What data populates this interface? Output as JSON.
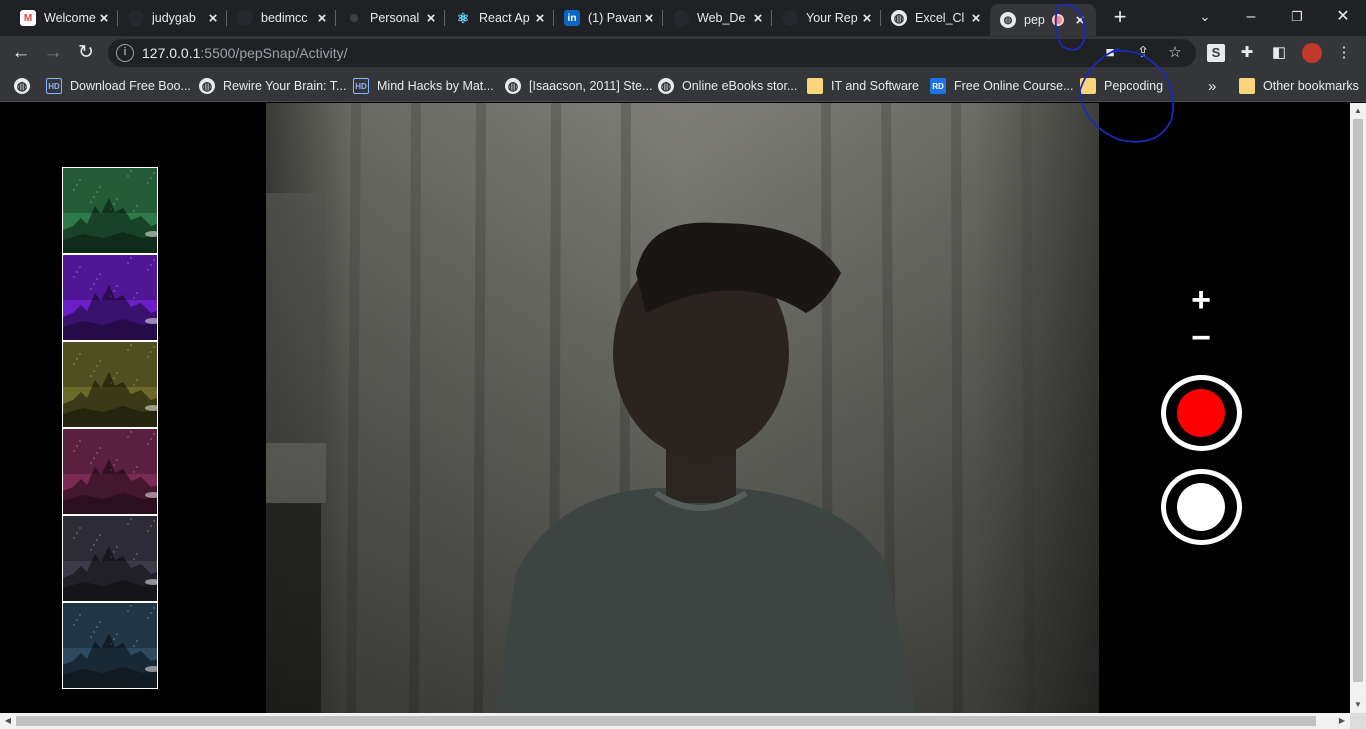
{
  "tabs": [
    {
      "title": "Welcome",
      "favicon": "gmail-icon"
    },
    {
      "title": "judygab",
      "favicon": "github-icon"
    },
    {
      "title": "bedimcc",
      "favicon": "github-icon"
    },
    {
      "title": "Personal",
      "favicon": "dot-icon"
    },
    {
      "title": "React Ap",
      "favicon": "react-icon"
    },
    {
      "title": "(1) Pavan",
      "favicon": "linkedin-icon"
    },
    {
      "title": "Web_De",
      "favicon": "github-icon"
    },
    {
      "title": "Your Rep",
      "favicon": "github-icon"
    },
    {
      "title": "Excel_Cl",
      "favicon": "globe-icon"
    },
    {
      "title": "pep",
      "favicon": "globe-icon",
      "active": true,
      "recording": true
    }
  ],
  "toolbar": {
    "url_host": "127.0.0.1",
    "url_path": ":5500/pepSnap/Activity/"
  },
  "bookmarks": [
    {
      "label": "Download Free Boo...",
      "icon": "hd-icon"
    },
    {
      "label": "Rewire Your Brain: T...",
      "icon": "globe-icon"
    },
    {
      "label": "Mind Hacks by Mat...",
      "icon": "hd-icon"
    },
    {
      "label": "[Isaacson, 2011] Ste...",
      "icon": "globe-icon"
    },
    {
      "label": "Online eBooks stor...",
      "icon": "globe-icon"
    },
    {
      "label": "IT and Software",
      "icon": "folder-icon"
    },
    {
      "label": "Free Online Course...",
      "icon": "rd-icon"
    },
    {
      "label": "Pepcoding",
      "icon": "folder-icon"
    }
  ],
  "bookmarks_overflow": "»",
  "other_bookmarks": "Other bookmarks",
  "filters": [
    {
      "name": "green",
      "tint": "#2f7a4a"
    },
    {
      "name": "purple",
      "tint": "#6a1fc8"
    },
    {
      "name": "olive",
      "tint": "#6b6a2a"
    },
    {
      "name": "magenta",
      "tint": "#7a2a55"
    },
    {
      "name": "dusk",
      "tint": "#3c3a48"
    },
    {
      "name": "blue",
      "tint": "#2d4a60"
    }
  ],
  "controls": {
    "zoom_in": "+",
    "zoom_out": "−"
  }
}
